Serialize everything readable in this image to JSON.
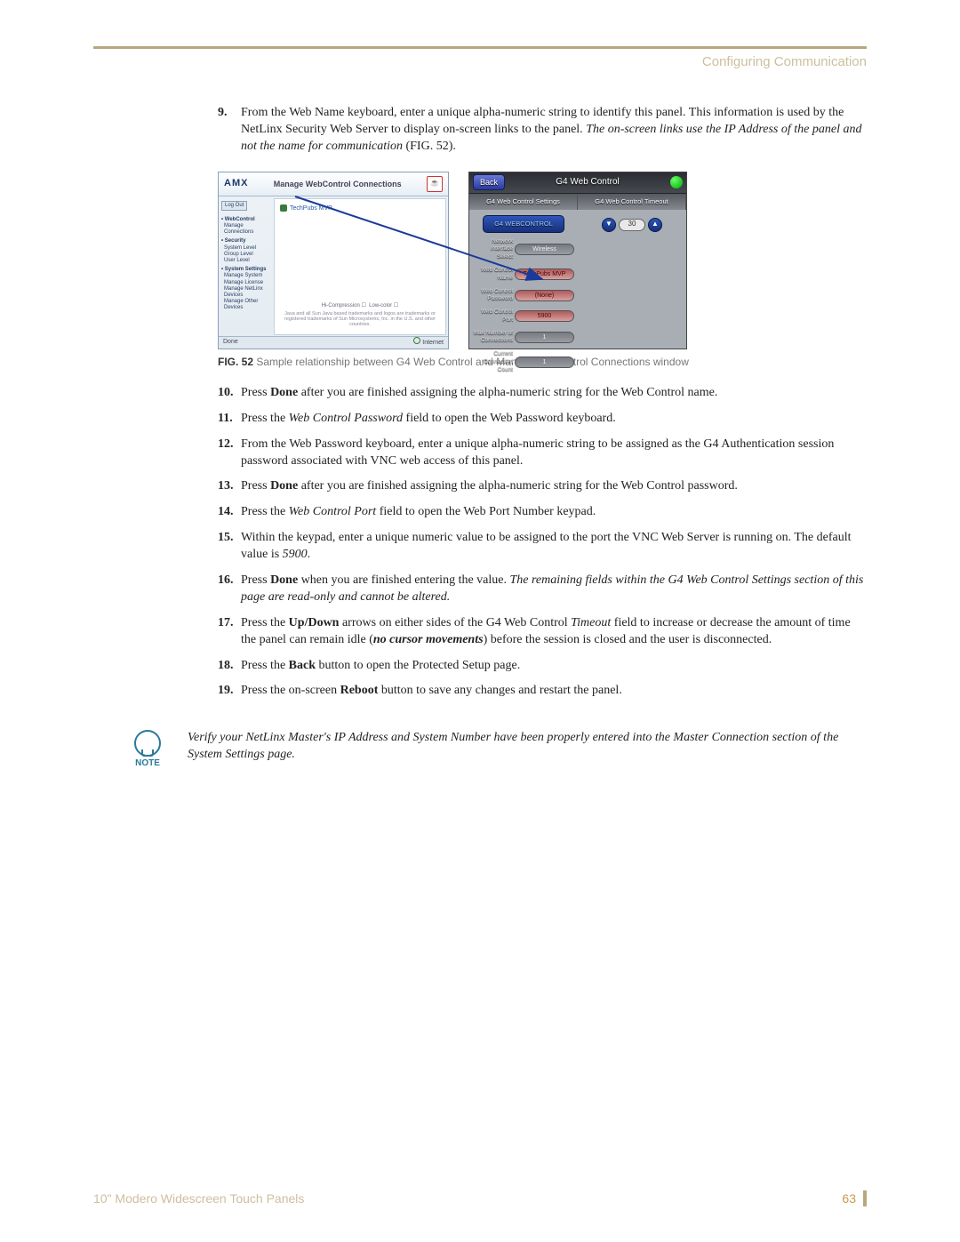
{
  "header": {
    "section": "Configuring Communication"
  },
  "steps": [
    {
      "n": "9.",
      "html": "From the Web Name keyboard, enter a unique alpha-numeric string to identify this panel. This information is used by the NetLinx Security Web Server to display on-screen links to the panel. <i>The on-screen links use the IP Address of the panel and not the name for communication</i> (FIG. 52)."
    },
    {
      "n": "10.",
      "html": "Press <b>Done</b> after you are finished assigning the alpha-numeric string for the Web Control name."
    },
    {
      "n": "11.",
      "html": "Press the <i>Web Control Password</i> field to open the Web Password keyboard."
    },
    {
      "n": "12.",
      "html": "From the Web Password keyboard, enter a unique alpha-numeric string to be assigned as the G4 Authentication session password associated with VNC web access of this panel."
    },
    {
      "n": "13.",
      "html": "Press <b>Done</b> after you are finished assigning the alpha-numeric string for the Web Control password."
    },
    {
      "n": "14.",
      "html": "Press the <i>Web Control Port</i> field to open the Web Port Number keypad."
    },
    {
      "n": "15.",
      "html": "Within the keypad, enter a unique numeric value to be assigned to the port the VNC Web Server is running on. The default value is <i>5900</i>."
    },
    {
      "n": "16.",
      "html": "Press <b>Done</b> when you are finished entering the value. <i>The remaining fields within the G4 Web Control Settings section of this page are read-only and cannot be altered.</i>"
    },
    {
      "n": "17.",
      "html": "Press the <b>Up/Down</b> arrows on either sides of the G4 Web Control <i>Timeout</i> field to increase or decrease the amount of time the panel can remain idle (<i><b>no cursor movements</b></i>) before the session is closed and the user is disconnected."
    },
    {
      "n": "18.",
      "html": "Press the <b>Back</b> button to open the Protected Setup page."
    },
    {
      "n": "19.",
      "html": "Press the on-screen <b>Reboot</b> button to save any changes and restart the panel."
    }
  ],
  "figure": {
    "label": "FIG. 52",
    "caption": "Sample relationship between G4 Web Control and Mange WebControl Connections window",
    "web": {
      "brand": "AMX",
      "title": "Manage WebControl Connections",
      "java": "Java",
      "sidebar_btn": "Log Out",
      "nav": [
        {
          "grp": "WebControl",
          "subs": [
            "Manage Connections"
          ]
        },
        {
          "grp": "Security",
          "subs": [
            "System Level",
            "Group Level",
            "User Level"
          ]
        },
        {
          "grp": "System Settings",
          "subs": [
            "Manage System",
            "Manage License",
            "Manage NetLinx Devices",
            "Manage Other Devices"
          ]
        }
      ],
      "link": "TechPubs MVP",
      "compress": "Hi-Compression",
      "lowcolor": "Low-color",
      "copy": "Java and all Sun Java based trademarks and logos are trademarks or registered trademarks of Sun Microsystems, Inc. in the U.S. and other countries.",
      "status_done": "Done",
      "status_net": "Internet"
    },
    "panel": {
      "back": "Back",
      "title": "G4 Web Control",
      "tab1": "G4 Web Control Settings",
      "tab2": "G4 Web Control Timeout",
      "enable_btn": "G4 WEBCONTROL",
      "rows": [
        {
          "lbl": "Network Interface Select",
          "val": "Wireless"
        },
        {
          "lbl": "Web Control Name",
          "val": "TechPubs MVP",
          "red": true
        },
        {
          "lbl": "Web Control Password",
          "val": "(None)",
          "red": true
        },
        {
          "lbl": "Web Control Port",
          "val": "5900",
          "red": true
        },
        {
          "lbl": "Max Number of Connections",
          "val": "1"
        },
        {
          "lbl": "Current Connection Count",
          "val": "1"
        }
      ],
      "timeout": "30"
    }
  },
  "note": {
    "label": "NOTE",
    "text": "Verify your NetLinx Master's IP Address and System Number have been properly entered into the Master Connection section of the System Settings page."
  },
  "footer": {
    "product": "10\" Modero Widescreen Touch Panels",
    "page": "63"
  }
}
